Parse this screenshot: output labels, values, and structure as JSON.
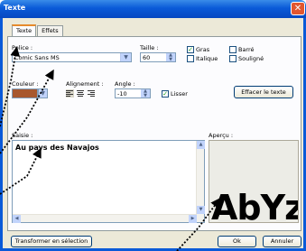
{
  "window": {
    "title": "Texte",
    "close_icon": "close-icon"
  },
  "tabs": [
    {
      "label": "Texte",
      "active": true
    },
    {
      "label": "Effets",
      "active": false
    }
  ],
  "font": {
    "label": "Police :",
    "value": "Comic Sans MS"
  },
  "size": {
    "label": "Taille :",
    "value": "60"
  },
  "styles": [
    {
      "label": "Gras",
      "checked": true
    },
    {
      "label": "Barré",
      "checked": false
    },
    {
      "label": "Italique",
      "checked": false
    },
    {
      "label": "Souligné",
      "checked": false
    }
  ],
  "color": {
    "label": "Couleur :",
    "value": "#a8582e"
  },
  "alignment": {
    "label": "Alignement :"
  },
  "angle": {
    "label": "Angle :",
    "value": "-10"
  },
  "smooth": {
    "label": "Lisser",
    "checked": true
  },
  "clear_button": "Effacer le texte",
  "input": {
    "label": "Saisie :",
    "value": "Au pays des Navajos"
  },
  "preview": {
    "label": "Aperçu :",
    "text": "AbYz"
  },
  "footer": {
    "transform_button": "Transformer en sélection",
    "ok_button": "Ok",
    "cancel_button": "Annuler"
  }
}
